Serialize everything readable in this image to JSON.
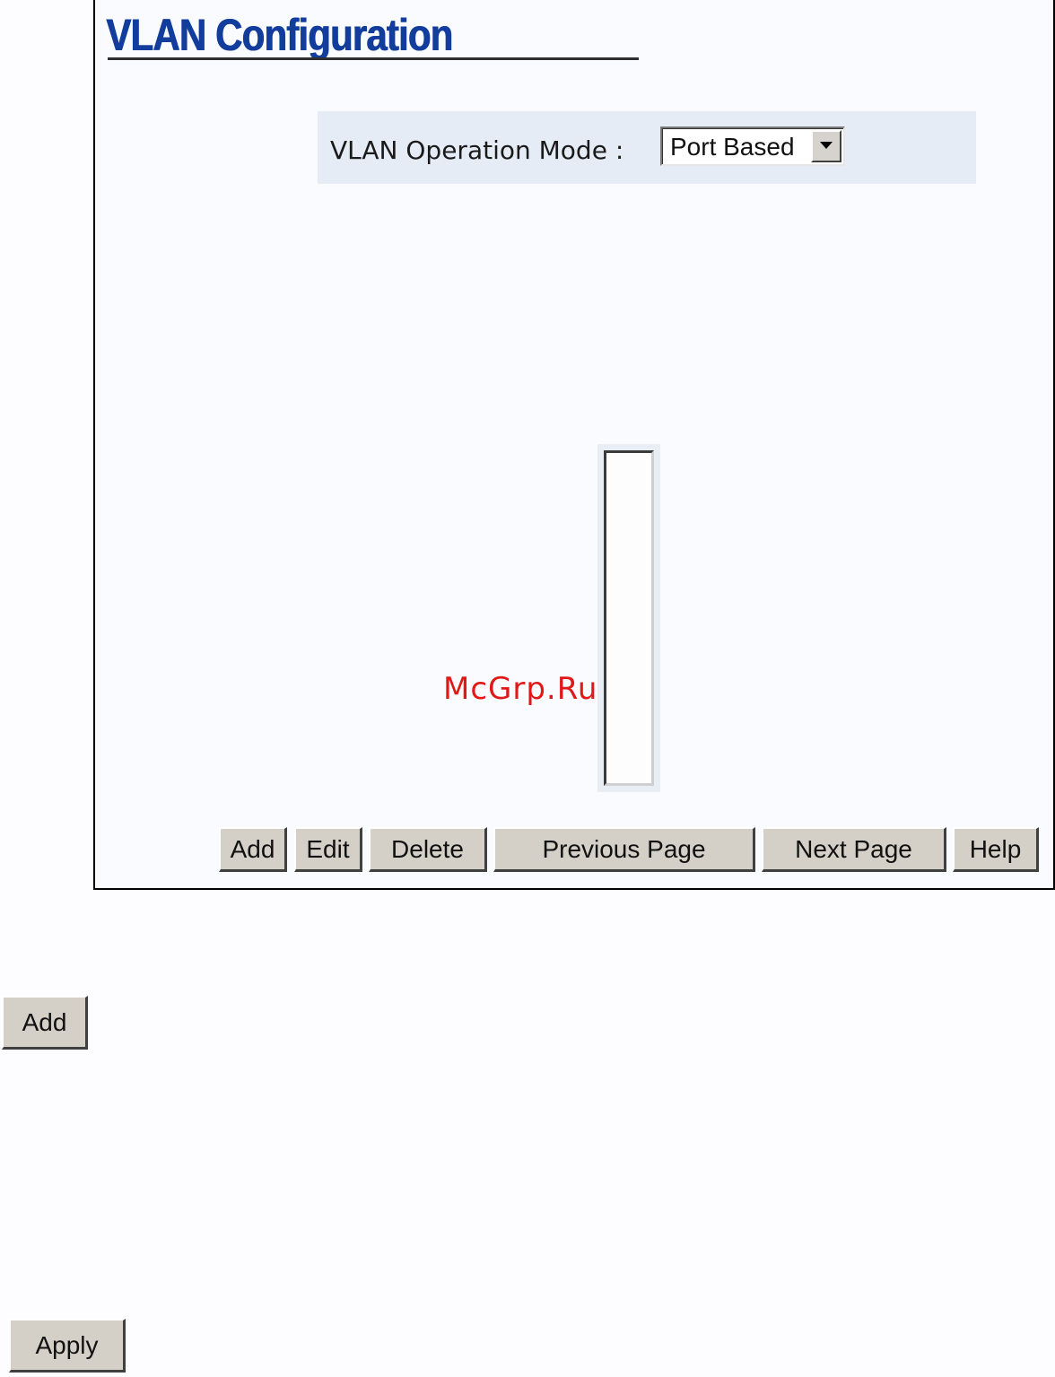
{
  "page": {
    "title": "VLAN Configuration",
    "title_color": "#123d9c"
  },
  "mode": {
    "label": "VLAN Operation Mode :",
    "selected": "Port Based",
    "row_background": "#e6ecf6"
  },
  "vlan_list": {
    "items": []
  },
  "toolbar": {
    "add_label": "Add",
    "edit_label": "Edit",
    "delete_label": "Delete",
    "previous_page_label": "Previous Page",
    "next_page_label": "Next Page",
    "help_label": "Help"
  },
  "extras": {
    "add_label": "Add",
    "apply_label": "Apply"
  },
  "watermark": {
    "text": "McGrp.Ru",
    "color": "#e01818"
  }
}
